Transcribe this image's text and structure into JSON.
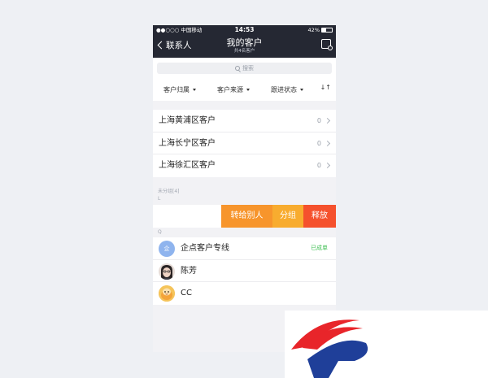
{
  "statusbar": {
    "carrier": "●●○○○ 中国移动",
    "time": "14:53",
    "battery": "42%"
  },
  "navbar": {
    "back_label": "联系人",
    "title": "我的客户",
    "subtitle": "共4名客户"
  },
  "search": {
    "placeholder": "搜索"
  },
  "filters": [
    {
      "label": "客户归属"
    },
    {
      "label": "客户来源"
    },
    {
      "label": "跟进状态"
    }
  ],
  "sort_icon": "↓↑",
  "groups": [
    {
      "name": "上海黄浦区客户",
      "count": "0"
    },
    {
      "name": "上海长宁区客户",
      "count": "0"
    },
    {
      "name": "上海徐汇区客户",
      "count": "0"
    }
  ],
  "ungrouped": {
    "header": "未分组[4]",
    "letter_l": "L",
    "letter_q": "Q"
  },
  "swipe_actions": {
    "transfer": "转给别人",
    "group": "分组",
    "release": "释放"
  },
  "contacts": [
    {
      "name": "企点客户专线",
      "avatar_text": "企",
      "badge": "已成单"
    },
    {
      "name": "陈芳",
      "avatar_text": "",
      "badge": ""
    },
    {
      "name": "CC",
      "avatar_text": "",
      "badge": ""
    }
  ],
  "colors": {
    "navbar": "#252833",
    "transfer": "#f7952c",
    "group": "#f8ac2f",
    "release": "#f5512d",
    "badge": "#3fbf53",
    "logo_red": "#e8252a",
    "logo_blue": "#1f3f99"
  }
}
